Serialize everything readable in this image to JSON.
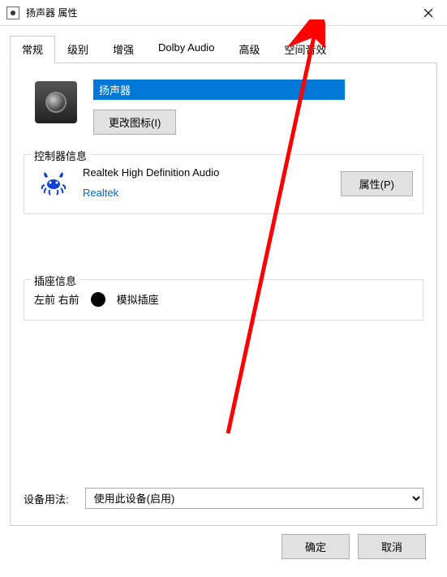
{
  "window": {
    "title": "扬声器 属性"
  },
  "tabs": {
    "items": [
      {
        "label": "常规"
      },
      {
        "label": "级别"
      },
      {
        "label": "增强"
      },
      {
        "label": "Dolby Audio"
      },
      {
        "label": "高级"
      },
      {
        "label": "空间音效"
      }
    ],
    "active_index": 0
  },
  "device": {
    "name": "扬声器",
    "change_icon_button": "更改图标(I)"
  },
  "controller": {
    "legend": "控制器信息",
    "name": "Realtek High Definition Audio",
    "vendor": "Realtek",
    "properties_button": "属性(P)"
  },
  "jack": {
    "legend": "插座信息",
    "location": "左前 右前",
    "type": "模拟插座"
  },
  "usage": {
    "label": "设备用法:",
    "selected": "使用此设备(启用)"
  },
  "footer": {
    "ok": "确定",
    "cancel": "取消"
  }
}
